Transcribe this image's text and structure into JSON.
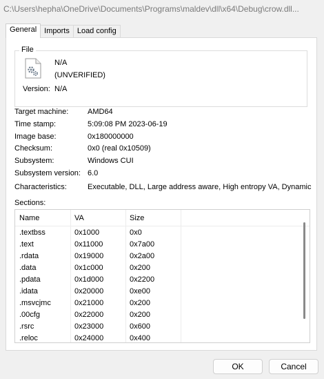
{
  "window": {
    "title": "C:\\Users\\hepha\\OneDrive\\Documents\\Programs\\maldev\\dll\\x64\\Debug\\crow.dll..."
  },
  "tabs": [
    {
      "label": "General"
    },
    {
      "label": "Imports"
    },
    {
      "label": "Load config"
    }
  ],
  "file": {
    "group_label": "File",
    "icon": "dll-file-gear-icon",
    "name": "N/A",
    "status": "(UNVERIFIED)",
    "version_label": "Version:",
    "version_value": "N/A"
  },
  "properties": [
    {
      "label": "Target machine:",
      "value": "AMD64"
    },
    {
      "label": "Time stamp:",
      "value": "5:09:08 PM 2023-06-19"
    },
    {
      "label": "Image base:",
      "value": "0x180000000"
    },
    {
      "label": "Checksum:",
      "value": "0x0 (real 0x10509)"
    },
    {
      "label": "Subsystem:",
      "value": "Windows CUI"
    },
    {
      "label": "Subsystem version:",
      "value": "6.0"
    },
    {
      "label": "Characteristics:",
      "value": "Executable, DLL, Large address aware, High entropy VA, Dynamic b"
    }
  ],
  "sections": {
    "label": "Sections:",
    "columns": [
      "Name",
      "VA",
      "Size"
    ],
    "rows": [
      [
        ".textbss",
        "0x1000",
        "0x0"
      ],
      [
        ".text",
        "0x11000",
        "0x7a00"
      ],
      [
        ".rdata",
        "0x19000",
        "0x2a00"
      ],
      [
        ".data",
        "0x1c000",
        "0x200"
      ],
      [
        ".pdata",
        "0x1d000",
        "0x2200"
      ],
      [
        ".idata",
        "0x20000",
        "0xe00"
      ],
      [
        ".msvcjmc",
        "0x21000",
        "0x200"
      ],
      [
        ".00cfg",
        "0x22000",
        "0x200"
      ],
      [
        ".rsrc",
        "0x23000",
        "0x600"
      ],
      [
        ".reloc",
        "0x24000",
        "0x400"
      ]
    ]
  },
  "buttons": {
    "ok": "OK",
    "cancel": "Cancel"
  }
}
